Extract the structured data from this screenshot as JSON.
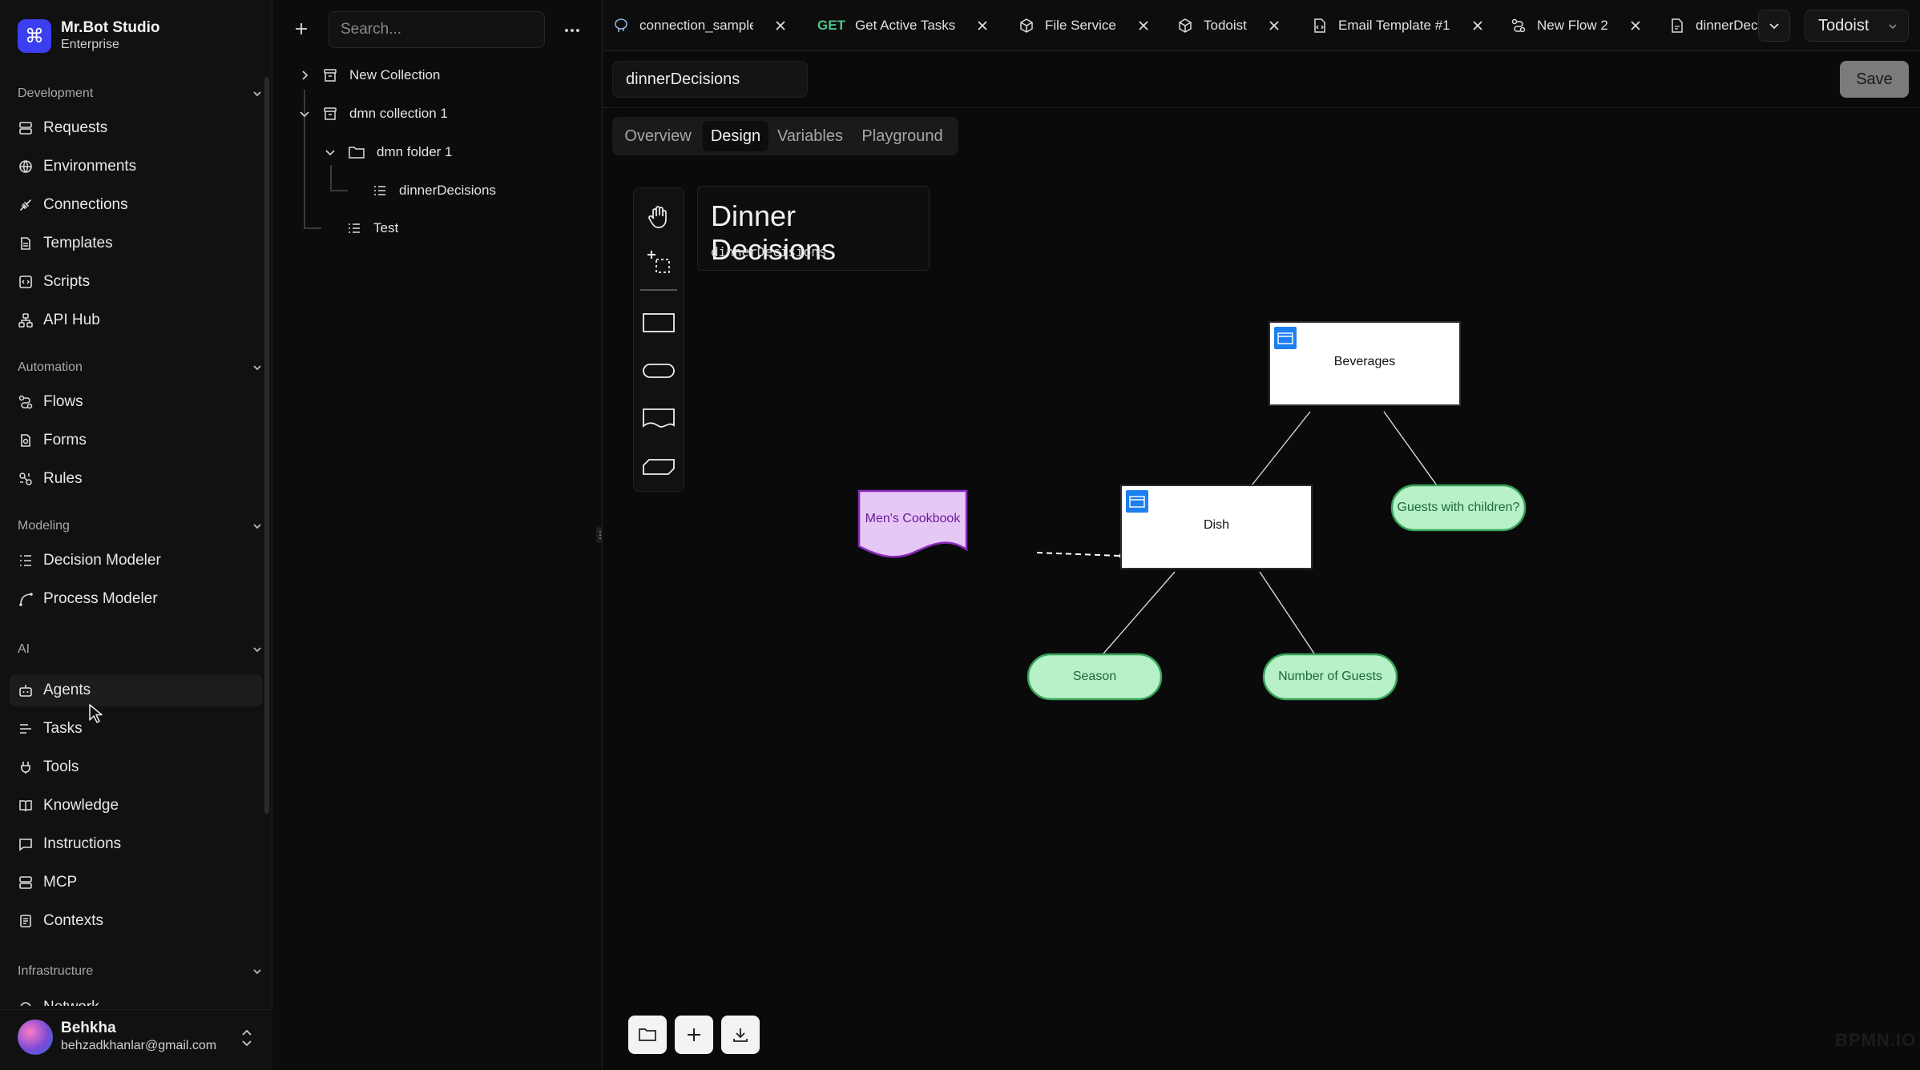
{
  "brand": {
    "name": "Mr.Bot Studio",
    "plan": "Enterprise",
    "logo_glyph": "⌘"
  },
  "nav": {
    "sections": [
      {
        "title": "Development",
        "items": [
          "Requests",
          "Environments",
          "Connections",
          "Templates",
          "Scripts",
          "API Hub"
        ]
      },
      {
        "title": "Automation",
        "items": [
          "Flows",
          "Forms",
          "Rules"
        ]
      },
      {
        "title": "Modeling",
        "items": [
          "Decision Modeler",
          "Process Modeler"
        ]
      },
      {
        "title": "AI",
        "items": [
          "Agents",
          "Tasks",
          "Tools",
          "Knowledge",
          "Instructions",
          "MCP",
          "Contexts"
        ]
      },
      {
        "title": "Infrastructure",
        "items": [
          "Network"
        ]
      }
    ],
    "active_item": "Agents",
    "icons": {
      "Requests": "server-icon",
      "Environments": "globe-icon",
      "Connections": "plug-icon",
      "Templates": "file-icon",
      "Scripts": "code-icon",
      "API Hub": "network-icon",
      "Flows": "flow-icon",
      "Forms": "form-icon",
      "Rules": "rules-icon",
      "Decision Modeler": "list-tree-icon",
      "Process Modeler": "curve-icon",
      "Agents": "bot-icon",
      "Tasks": "tasks-icon",
      "Tools": "tool-icon",
      "Knowledge": "book-icon",
      "Instructions": "message-icon",
      "MCP": "server-icon",
      "Contexts": "document-icon"
    }
  },
  "user": {
    "name": "Behkha",
    "email": "behzadkhanlar@gmail.com"
  },
  "explorer": {
    "search_placeholder": "Search...",
    "tree": [
      "New Collection",
      "dmn collection 1",
      "dmn folder 1",
      "dinnerDecisions",
      "Test"
    ]
  },
  "tabs": [
    {
      "label": "connection_sample",
      "icon": "postgres-icon"
    },
    {
      "method": "GET",
      "label": "Get Active Tasks"
    },
    {
      "label": "File Service",
      "icon": "box-icon"
    },
    {
      "label": "Todoist",
      "icon": "box-icon"
    },
    {
      "label": "Email Template #1",
      "icon": "file-code-icon"
    },
    {
      "label": "New Flow 2",
      "icon": "flow-icon"
    },
    {
      "label": "dinnerDecisions",
      "icon": "file-dmn-icon"
    }
  ],
  "workspace": "Todoist",
  "editor": {
    "name_value": "dinnerDecisions",
    "save_label": "Save",
    "view_tabs": [
      "Overview",
      "Design",
      "Variables",
      "Playground"
    ],
    "active_view": "Design"
  },
  "diagram": {
    "title": "Dinner Decisions",
    "id": "dinnerDecisions",
    "decisions": [
      "Beverages",
      "Dish"
    ],
    "inputs": [
      "Guests with children?",
      "Season",
      "Number of Guests"
    ],
    "knowledge_source": "Men's Cookbook",
    "colors": {
      "decision_fill": "#ffffff",
      "decision_badge": "#1e7ff0",
      "input_fill": "#b8f0c8",
      "input_stroke": "#37a35a",
      "input_text": "#1d6b35",
      "source_fill": "#e6c8f7",
      "source_stroke": "#8a2bbd",
      "source_text": "#6a1b9a"
    }
  },
  "watermark": "BPMN.IO"
}
